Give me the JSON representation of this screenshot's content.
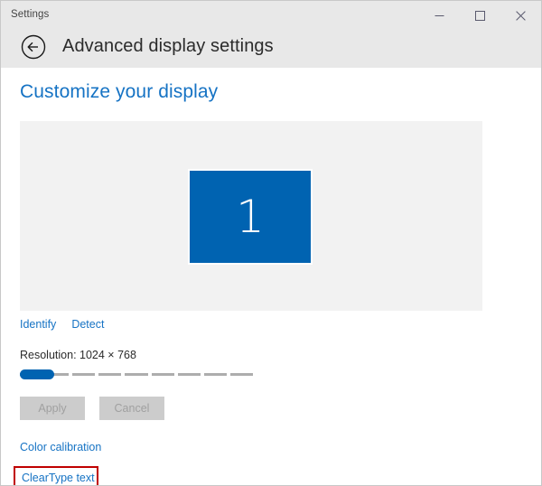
{
  "window": {
    "title": "Settings",
    "caption_buttons": [
      {
        "name": "minimize",
        "icon": "minimize-icon",
        "label": "Minimize"
      },
      {
        "name": "maximize",
        "icon": "maximize-icon",
        "label": "Maximize"
      },
      {
        "name": "close",
        "icon": "close-icon",
        "label": "Close"
      }
    ]
  },
  "header": {
    "back_icon": "back-arrow-icon",
    "title": "Advanced display settings"
  },
  "main": {
    "section_title": "Customize your display",
    "monitor": {
      "number": "1",
      "color": "#0063b1"
    },
    "links": {
      "identify": "Identify",
      "detect": "Detect",
      "color_calibration": "Color calibration",
      "cleartype_text": "ClearType text"
    },
    "resolution": {
      "label": "Resolution: 1024 × 768",
      "value": "1024 × 768",
      "slider_position_percent": 0
    },
    "buttons": {
      "apply": "Apply",
      "cancel": "Cancel"
    }
  },
  "colors": {
    "accent": "#0063b1",
    "link": "#1673c4",
    "titlebar": "#e8e8e8",
    "preview_panel": "#f2f2f2",
    "highlight_box": "#c00000"
  }
}
